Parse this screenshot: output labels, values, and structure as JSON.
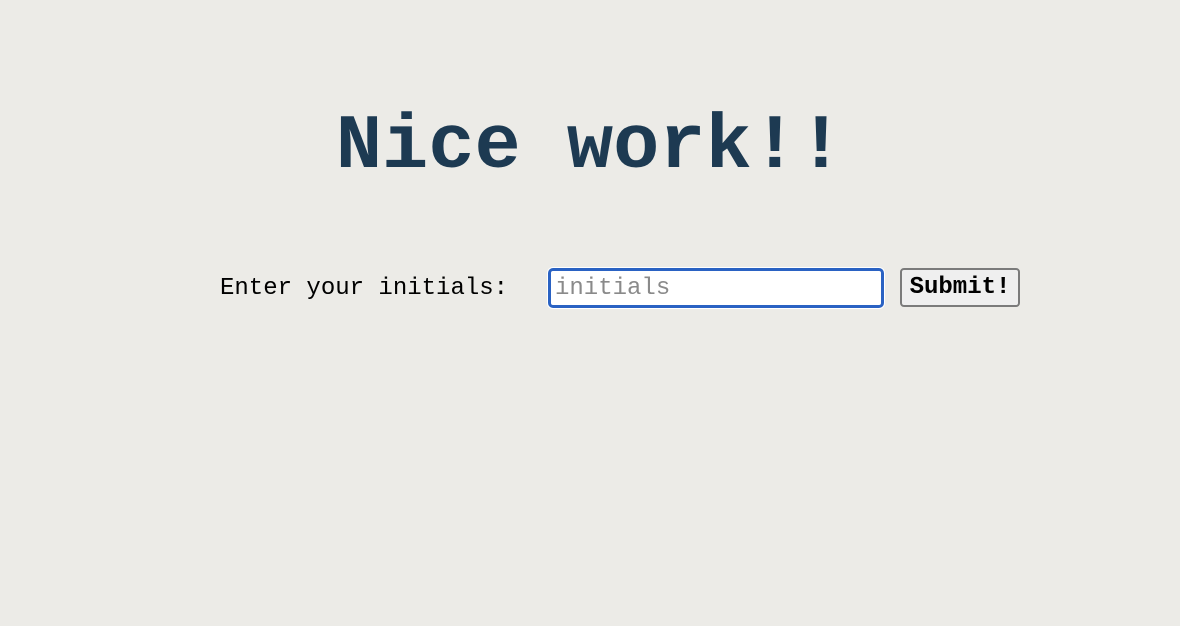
{
  "headline": "Nice work!!",
  "form": {
    "label": "Enter your initials:",
    "input_value": "",
    "input_placeholder": "initials",
    "submit_label": "Submit!"
  },
  "colors": {
    "background": "#ecebe7",
    "headline": "#1d3a52",
    "input_focus_border": "#2a62c3"
  }
}
